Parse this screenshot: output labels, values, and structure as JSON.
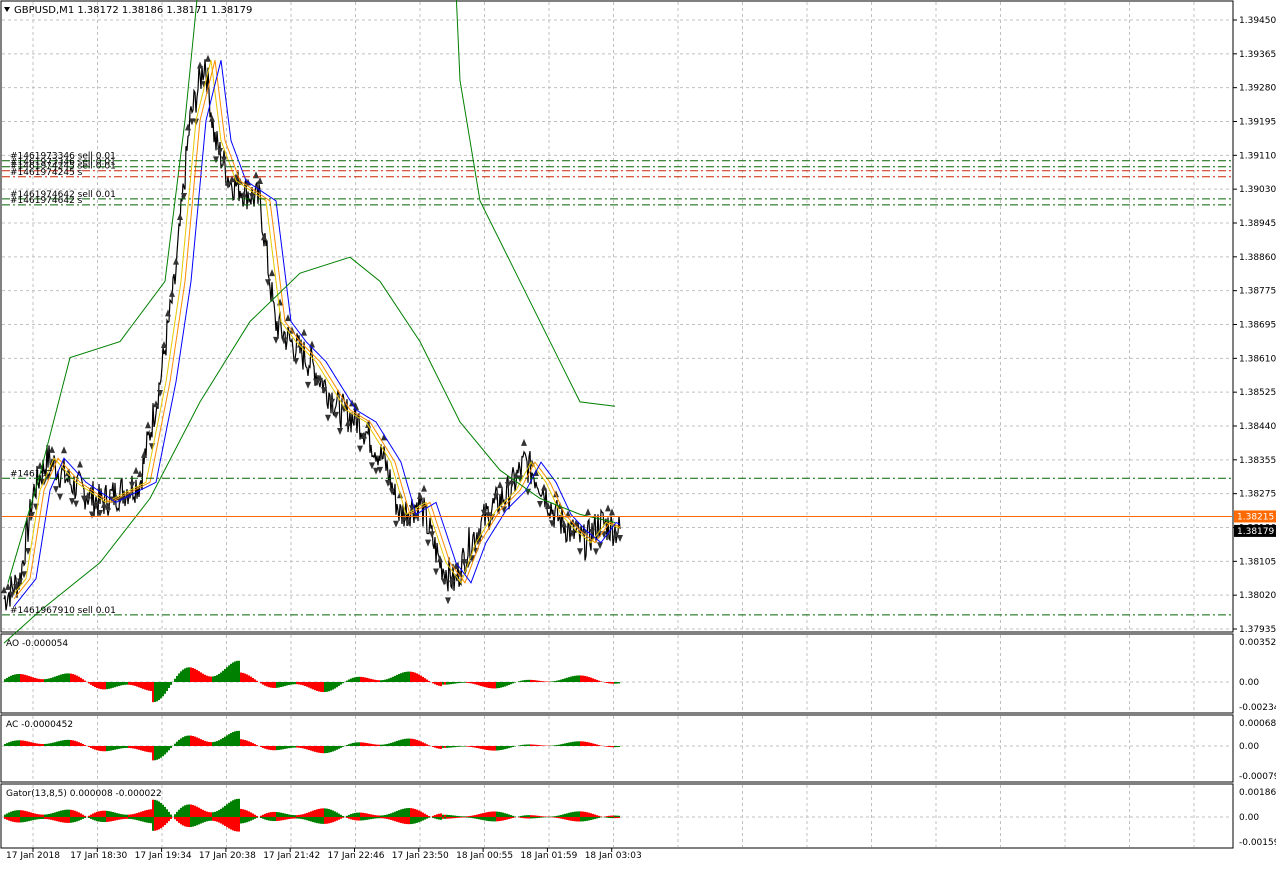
{
  "symbol_header": "GBPUSD,M1  1.38172 1.38186 1.38171 1.38179",
  "colors": {
    "background": "#ffffff",
    "grid": "#c0c0c0",
    "candles": "#000000",
    "bollinger": "#008000",
    "ma_blue": "#0000ff",
    "ma_orange": "#ff8c00",
    "ma_yellow": "#e8c800",
    "ask_line": "#ff6a00",
    "order_line": "#006400",
    "order_line_red": "#cc2200",
    "histo_up": "#008000",
    "histo_down": "#ff0000",
    "price_box": "#000000",
    "ask_box": "#ff6a00"
  },
  "price_axis": {
    "ticks": [
      "1.39450",
      "1.39365",
      "1.39280",
      "1.39195",
      "1.39110",
      "1.39030",
      "1.38945",
      "1.38860",
      "1.38775",
      "1.38695",
      "1.38610",
      "1.38525",
      "1.38440",
      "1.38355",
      "1.38275",
      "1.38190",
      "1.38105",
      "1.38020",
      "1.37935"
    ],
    "current_bid": "1.38179",
    "current_ask": "1.38215",
    "min": 1.37935,
    "max": 1.3945
  },
  "order_labels": [
    "#1461973346 sell 0.01",
    "#1461973346 sell 0.01",
    "#1461974245 sell 0.01",
    "#1461974245 s",
    "#1461974642 sell 0.01",
    "#1461974642 s",
    "#146197",
    "#1461967910 sell 0.01"
  ],
  "order_levels": [
    1.391,
    1.39085,
    1.39075,
    1.3906,
    1.39005,
    1.3899,
    1.3831,
    1.3797
  ],
  "indicators": {
    "ao": {
      "title": "AO -0.000054",
      "ticks": [
        "0.003525",
        "0.00",
        "-0.002343"
      ]
    },
    "ac": {
      "title": "AC -0.0000452",
      "ticks": [
        "0.000685",
        "0.00",
        "-0.000793"
      ]
    },
    "gator": {
      "title": "Gator(13,8,5) 0.000008 -0.000022",
      "ticks": [
        "0.001867",
        "0.00",
        "-0.00159"
      ]
    }
  },
  "time_axis": [
    "17 Jan 2018",
    "17 Jan 18:30",
    "17 Jan 19:34",
    "17 Jan 20:38",
    "17 Jan 21:42",
    "17 Jan 22:46",
    "17 Jan 23:50",
    "18 Jan 00:55",
    "18 Jan 01:59",
    "18 Jan 03:03"
  ],
  "menu_icon": "triangle-down-icon"
}
